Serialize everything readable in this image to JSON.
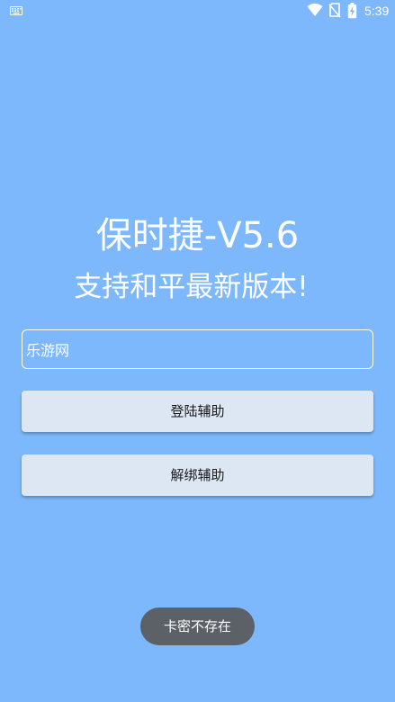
{
  "status_bar": {
    "time": "5:39",
    "icons": [
      "keyboard-icon",
      "wifi-icon",
      "no-sim-icon",
      "battery-charging-icon"
    ]
  },
  "app": {
    "title": "保时捷-V5.6",
    "subtitle": "支持和平最新版本!"
  },
  "form": {
    "card_key_value": "乐游网",
    "login_label": "登陆辅助",
    "unbind_label": "解绑辅助"
  },
  "toast": {
    "message": "卡密不存在"
  },
  "colors": {
    "background": "#7db8fc",
    "button_bg": "#dde7f4",
    "toast_bg": "#5c6168"
  }
}
